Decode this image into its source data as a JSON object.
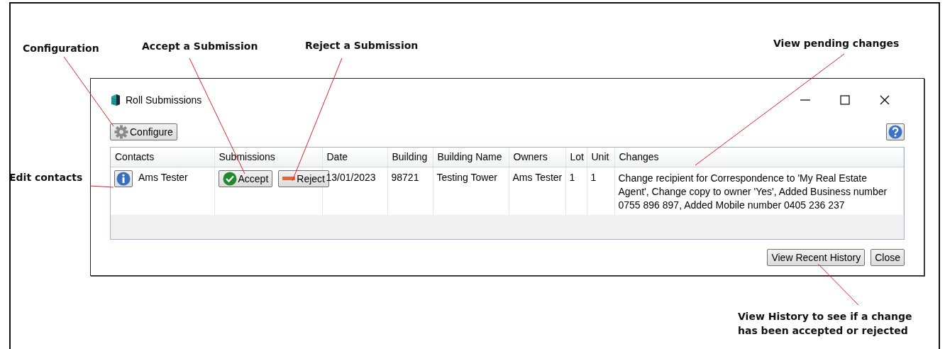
{
  "annotations": [
    {
      "text": "Configuration"
    },
    {
      "text": "Accept a Submission"
    },
    {
      "text": "Reject a Submission"
    },
    {
      "text": "View pending changes"
    },
    {
      "text": "Edit contacts"
    },
    {
      "text": "View History to see if a change has been accepted or rejected"
    }
  ],
  "window": {
    "title": "Roll Submissions"
  },
  "toolbar": {
    "configure_button": "Configure"
  },
  "table": {
    "columns": [
      "Contacts",
      "Submissions",
      "Date",
      "Building",
      "Building Name",
      "Owners",
      "Lot",
      "Unit",
      "Changes"
    ],
    "rows": [
      {
        "contact": "Ams Tester",
        "accept_button": "Accept",
        "reject_button": "Reject",
        "date": "13/01/2023",
        "building": "98721",
        "building_name": "Testing Tower",
        "owners": "Ams Tester",
        "lot": "1",
        "unit": "1",
        "changes": "Change recipient for Correspondence to 'My Real Estate Agent', Change copy to owner 'Yes', Added Business number 0755 896 897, Added Mobile number 0405 236 237"
      }
    ]
  },
  "footer_buttons": [
    "View Recent History",
    "Close"
  ]
}
